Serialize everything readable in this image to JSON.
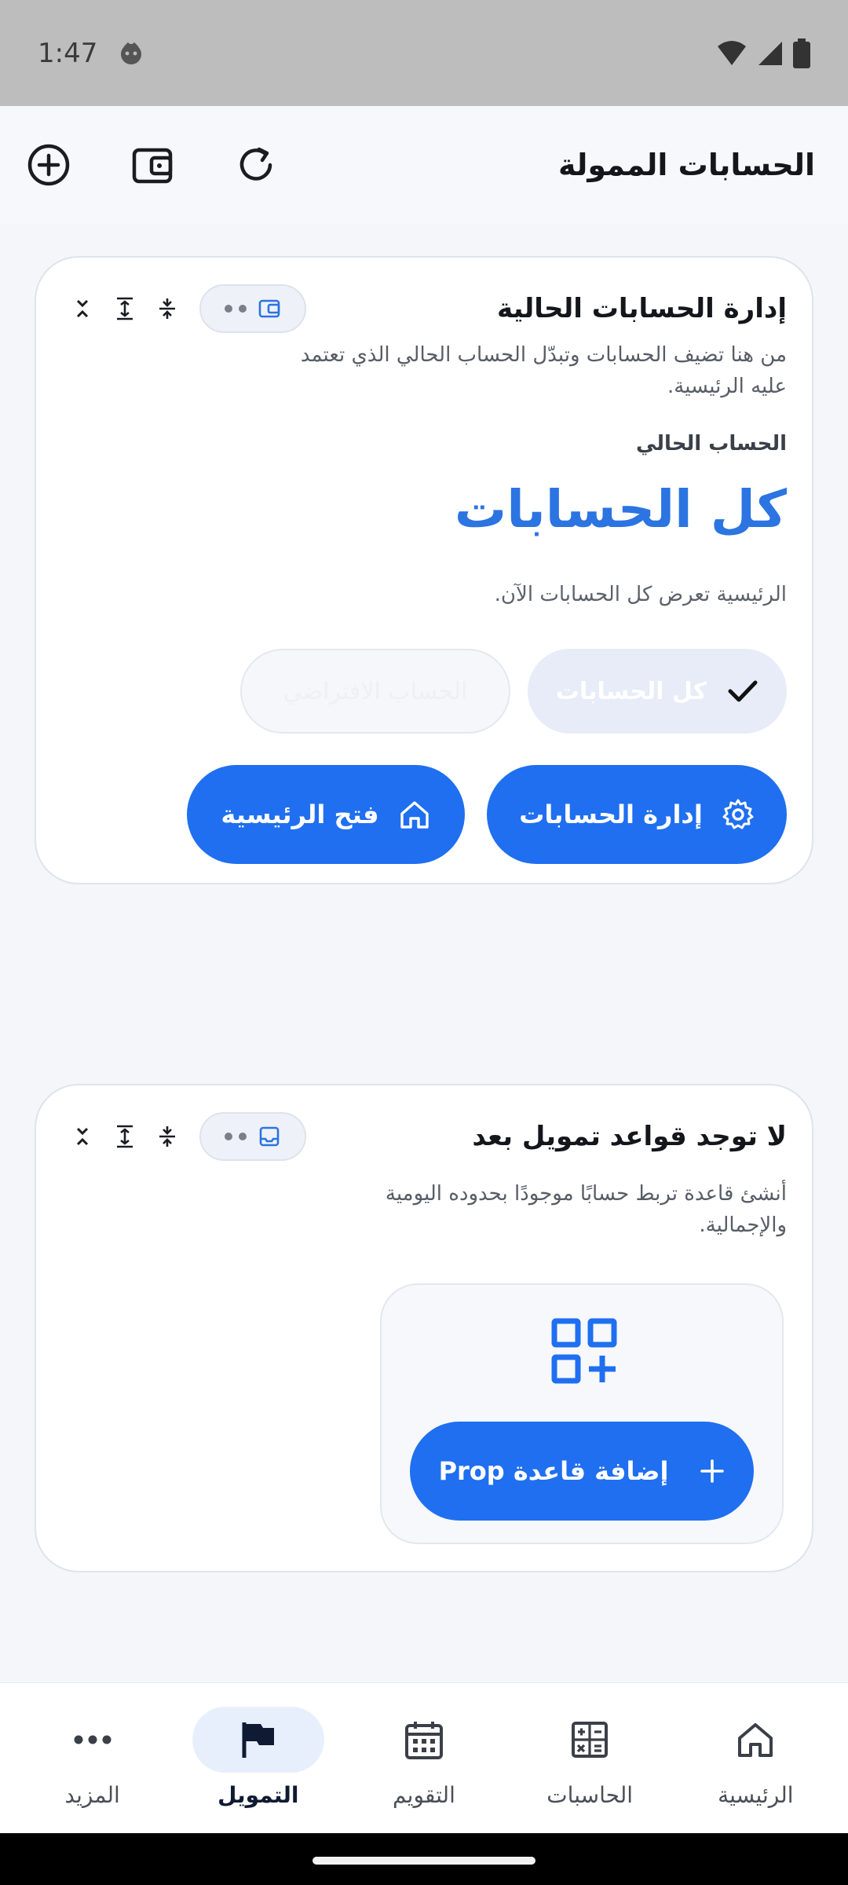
{
  "status_bar": {
    "time": "1:47"
  },
  "header": {
    "title": "الحسابات الممولة"
  },
  "accounts_card": {
    "title": "إدارة الحسابات الحالية",
    "description": "من هنا تضيف الحسابات وتبدّل الحساب الحالي الذي تعتمد عليه الرئيسية.",
    "current_label": "الحساب الحالي",
    "current_value": "كل الحسابات",
    "status_text": "الرئيسية تعرض كل الحسابات الآن.",
    "chip_selected": "كل الحسابات",
    "chip_disabled": "الحساب الافتراضي",
    "manage_button": "إدارة الحسابات",
    "home_button": "فتح الرئيسية"
  },
  "rules_card": {
    "title": "لا توجد قواعد تمويل بعد",
    "description": "أنشئ قاعدة تربط حسابًا موجودًا بحدوده اليومية والإجمالية.",
    "add_button": "إضافة قاعدة Prop"
  },
  "bottom_nav": {
    "items": [
      {
        "label": "الرئيسية",
        "icon": "home-icon",
        "active": false
      },
      {
        "label": "الحاسبات",
        "icon": "calculator-icon",
        "active": false
      },
      {
        "label": "التقويم",
        "icon": "calendar-icon",
        "active": false
      },
      {
        "label": "التمويل",
        "icon": "flag-icon",
        "active": true
      },
      {
        "label": "المزيد",
        "icon": "more-icon",
        "active": false
      }
    ]
  },
  "colors": {
    "accent": "#1f6ff0",
    "accent_text": "#2b74e2",
    "background": "#f4f6fa"
  }
}
